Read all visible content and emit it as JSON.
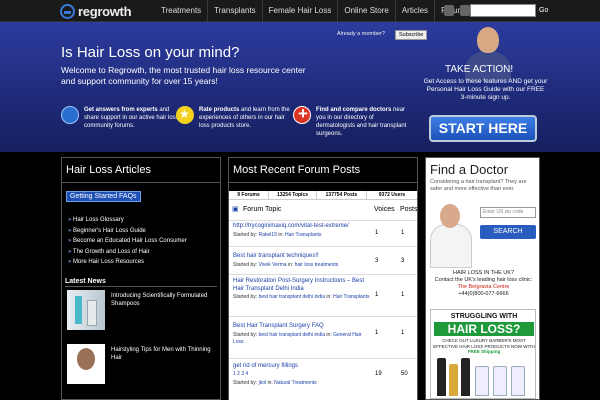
{
  "brand": {
    "name": "regrowth"
  },
  "nav": {
    "items": [
      "Treatments",
      "Transplants",
      "Female Hair Loss",
      "Online Store",
      "Articles",
      "Forums"
    ],
    "go_label": "Go"
  },
  "hero": {
    "title": "Is Hair Loss on your mind?",
    "subtitle": "Welcome to Regrowth, the most trusted hair loss resource center and support community for over 15 years!",
    "member_text": "Already a member?",
    "subscribe_label": "Subscribe",
    "features": [
      {
        "icon": "chat-icon",
        "lead": "Get answers from experts",
        "text": "and share support in our active hair loss community forums."
      },
      {
        "icon": "star-icon",
        "lead": "Rate products",
        "text": "and learn from the experiences of others in our hair loss products store."
      },
      {
        "icon": "medical-cross-icon",
        "lead": "Find and compare doctors",
        "text": "near you in our directory of dermatologists and hair transplant surgeons."
      }
    ],
    "take_action": "TAKE ACTION!",
    "take_action_sub": "Get Access to these features AND get your Personal Hair Loss Guide with our FREE 3-minute sign up.",
    "start_label": "START HERE"
  },
  "articles": {
    "heading": "Hair Loss Articles",
    "faq_label": "Getting Started FAQs",
    "links": [
      "Hair Loss Glossary",
      "Beginner's Hair Loss Guide",
      "Become an Educated Hair Loss Consumer",
      "The Growth and Loss of Hair",
      "More Hair Loss Resources"
    ],
    "latest_news": "Latest News",
    "news": [
      {
        "title": "Introducing Scientifically Formulated Shampoos"
      },
      {
        "title": "Hairstyling Tips for Men with Thinning Hair"
      }
    ]
  },
  "forum": {
    "heading": "Most Recent Forum Posts",
    "stats": [
      "9 Forums",
      "13254 Topics",
      "137754 Posts",
      "9372 Users"
    ],
    "col_topic": "Forum Topic",
    "col_voices": "Voices",
    "col_posts": "Posts",
    "started_by": "Started by:",
    "in_label": "in:",
    "rows": [
      {
        "topic": "http://trycoginimaxiq.com/vital-test-extreme/",
        "author": "Rakel19",
        "forum": "Hair Transplants",
        "voices": "1",
        "posts": "1"
      },
      {
        "topic": "Best hair transplant techniques!!",
        "author": "Vivek Verma",
        "forum": "hair loss treatments",
        "voices": "3",
        "posts": "3"
      },
      {
        "topic": "Hair Restoration Post-Surgery Instructions – Best Hair Transplant Delhi India",
        "author": "best hair transplant delhi india",
        "forum": "Hair Transplants",
        "voices": "1",
        "posts": "1"
      },
      {
        "topic": "Best Hair Transplant Surgery FAQ",
        "author": "best hair transplant delhi india",
        "forum": "General Hair Loss",
        "voices": "1",
        "posts": "1"
      },
      {
        "topic": "get rid of mercury fillings",
        "pages": "1 2 3 4",
        "author": "jkol",
        "forum": "Natural Treatments",
        "voices": "19",
        "posts": "50"
      }
    ]
  },
  "doctor": {
    "heading": "Find a Doctor",
    "subtitle": "Considering a hair transplant? They are safer and more effective than ever.",
    "zip_placeholder": "Enter US zip code",
    "search_label": "SEARCH",
    "note_title": "HAIR LOSS IN THE UK?",
    "note_body": "Contact the UK's leading hair loss clinic:",
    "note_clinic": "The Belgravia Centre",
    "note_phone": "+44(0)800-077-6666"
  },
  "ad": {
    "line1": "STRUGGLING WITH",
    "line2": "HAIR LOSS?",
    "line3": "CHECK OUT LUXURY BARBER'S MOST EFFECTIVE HAIR LOSS PRODUCTS NOW WITH",
    "free": "FREE Shipping"
  },
  "colors": {
    "hero_top": "#2c3c9e",
    "hero_bottom": "#161f5e",
    "accent": "#2a5bbf",
    "link": "#1b3ea8"
  }
}
